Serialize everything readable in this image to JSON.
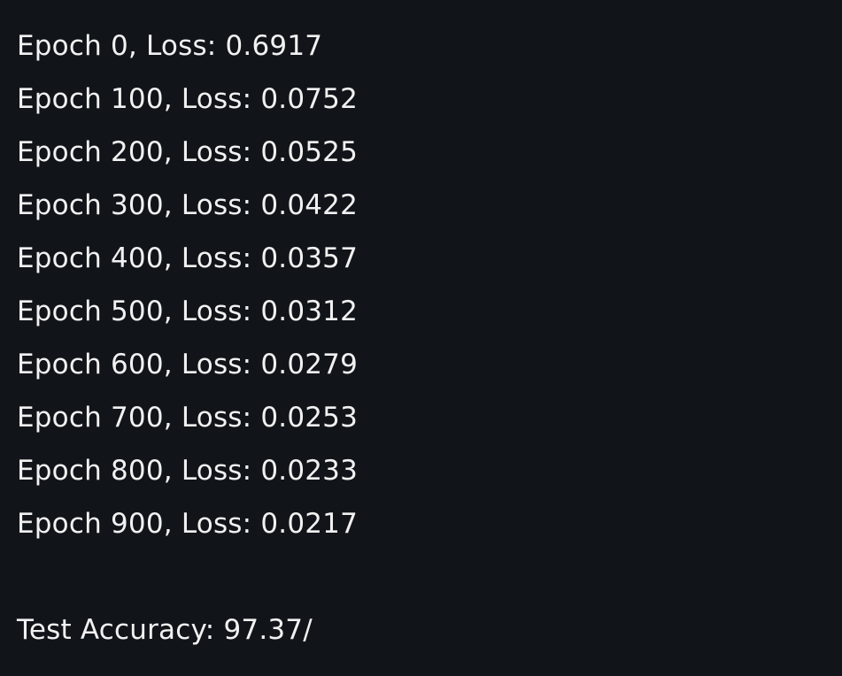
{
  "terminal": {
    "log_lines": [
      "Epoch 0, Loss: 0.6917",
      "Epoch 100, Loss: 0.0752",
      "Epoch 200, Loss: 0.0525",
      "Epoch 300, Loss: 0.0422",
      "Epoch 400, Loss: 0.0357",
      "Epoch 500, Loss: 0.0312",
      "Epoch 600, Loss: 0.0279",
      "Epoch 700, Loss: 0.0253",
      "Epoch 800, Loss: 0.0233",
      "Epoch 900, Loss: 0.0217"
    ],
    "test_accuracy_line": "Test Accuracy: 97.37/"
  },
  "colors": {
    "background": "#111519",
    "text": "#f1f1f1"
  }
}
